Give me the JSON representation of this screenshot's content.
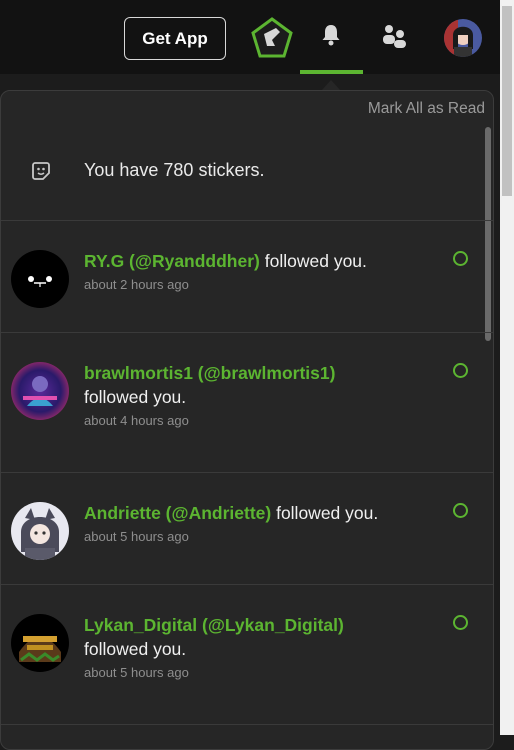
{
  "header": {
    "get_app_label": "Get App"
  },
  "icons": {
    "sticker": "sticker-icon",
    "bell": "bell-icon",
    "people": "people-icon",
    "pentagon": "pentagon-badge-icon"
  },
  "colors": {
    "accent": "#5cb531",
    "panel_bg": "#262626",
    "topbar_bg": "#121212"
  },
  "notifications_panel": {
    "mark_all_read": "Mark All as Read",
    "stickers_text": "You have 780 stickers.",
    "items": [
      {
        "name": "RY.G (@Ryandddher)",
        "action": "followed you.",
        "time": "about 2 hours ago"
      },
      {
        "name": "brawlmortis1 (@brawlmortis1)",
        "action": "followed you.",
        "time": "about 4 hours ago"
      },
      {
        "name": "Andriette (@Andriette)",
        "action": "followed you.",
        "time": "about 5 hours ago"
      },
      {
        "name": "Lykan_Digital (@Lykan_Digital)",
        "action": "followed you.",
        "time": "about 5 hours ago"
      }
    ]
  }
}
